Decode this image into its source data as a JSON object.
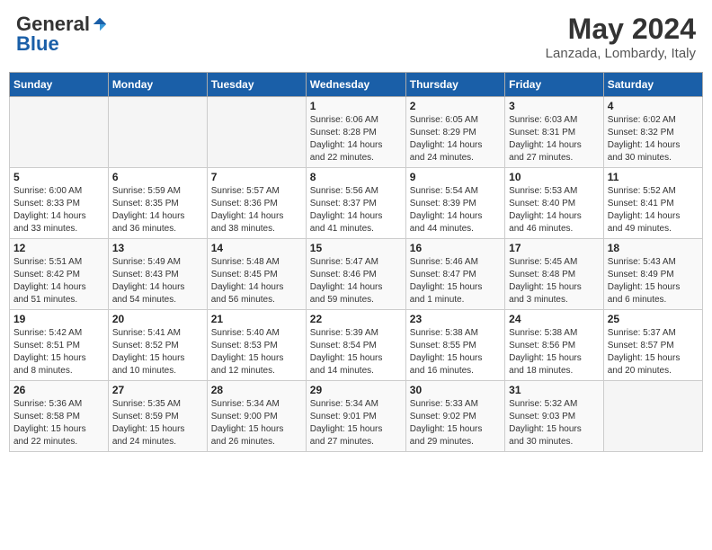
{
  "header": {
    "logo_general": "General",
    "logo_blue": "Blue",
    "title": "May 2024",
    "location": "Lanzada, Lombardy, Italy"
  },
  "weekdays": [
    "Sunday",
    "Monday",
    "Tuesday",
    "Wednesday",
    "Thursday",
    "Friday",
    "Saturday"
  ],
  "weeks": [
    [
      {
        "day": "",
        "info": ""
      },
      {
        "day": "",
        "info": ""
      },
      {
        "day": "",
        "info": ""
      },
      {
        "day": "1",
        "info": "Sunrise: 6:06 AM\nSunset: 8:28 PM\nDaylight: 14 hours\nand 22 minutes."
      },
      {
        "day": "2",
        "info": "Sunrise: 6:05 AM\nSunset: 8:29 PM\nDaylight: 14 hours\nand 24 minutes."
      },
      {
        "day": "3",
        "info": "Sunrise: 6:03 AM\nSunset: 8:31 PM\nDaylight: 14 hours\nand 27 minutes."
      },
      {
        "day": "4",
        "info": "Sunrise: 6:02 AM\nSunset: 8:32 PM\nDaylight: 14 hours\nand 30 minutes."
      }
    ],
    [
      {
        "day": "5",
        "info": "Sunrise: 6:00 AM\nSunset: 8:33 PM\nDaylight: 14 hours\nand 33 minutes."
      },
      {
        "day": "6",
        "info": "Sunrise: 5:59 AM\nSunset: 8:35 PM\nDaylight: 14 hours\nand 36 minutes."
      },
      {
        "day": "7",
        "info": "Sunrise: 5:57 AM\nSunset: 8:36 PM\nDaylight: 14 hours\nand 38 minutes."
      },
      {
        "day": "8",
        "info": "Sunrise: 5:56 AM\nSunset: 8:37 PM\nDaylight: 14 hours\nand 41 minutes."
      },
      {
        "day": "9",
        "info": "Sunrise: 5:54 AM\nSunset: 8:39 PM\nDaylight: 14 hours\nand 44 minutes."
      },
      {
        "day": "10",
        "info": "Sunrise: 5:53 AM\nSunset: 8:40 PM\nDaylight: 14 hours\nand 46 minutes."
      },
      {
        "day": "11",
        "info": "Sunrise: 5:52 AM\nSunset: 8:41 PM\nDaylight: 14 hours\nand 49 minutes."
      }
    ],
    [
      {
        "day": "12",
        "info": "Sunrise: 5:51 AM\nSunset: 8:42 PM\nDaylight: 14 hours\nand 51 minutes."
      },
      {
        "day": "13",
        "info": "Sunrise: 5:49 AM\nSunset: 8:43 PM\nDaylight: 14 hours\nand 54 minutes."
      },
      {
        "day": "14",
        "info": "Sunrise: 5:48 AM\nSunset: 8:45 PM\nDaylight: 14 hours\nand 56 minutes."
      },
      {
        "day": "15",
        "info": "Sunrise: 5:47 AM\nSunset: 8:46 PM\nDaylight: 14 hours\nand 59 minutes."
      },
      {
        "day": "16",
        "info": "Sunrise: 5:46 AM\nSunset: 8:47 PM\nDaylight: 15 hours\nand 1 minute."
      },
      {
        "day": "17",
        "info": "Sunrise: 5:45 AM\nSunset: 8:48 PM\nDaylight: 15 hours\nand 3 minutes."
      },
      {
        "day": "18",
        "info": "Sunrise: 5:43 AM\nSunset: 8:49 PM\nDaylight: 15 hours\nand 6 minutes."
      }
    ],
    [
      {
        "day": "19",
        "info": "Sunrise: 5:42 AM\nSunset: 8:51 PM\nDaylight: 15 hours\nand 8 minutes."
      },
      {
        "day": "20",
        "info": "Sunrise: 5:41 AM\nSunset: 8:52 PM\nDaylight: 15 hours\nand 10 minutes."
      },
      {
        "day": "21",
        "info": "Sunrise: 5:40 AM\nSunset: 8:53 PM\nDaylight: 15 hours\nand 12 minutes."
      },
      {
        "day": "22",
        "info": "Sunrise: 5:39 AM\nSunset: 8:54 PM\nDaylight: 15 hours\nand 14 minutes."
      },
      {
        "day": "23",
        "info": "Sunrise: 5:38 AM\nSunset: 8:55 PM\nDaylight: 15 hours\nand 16 minutes."
      },
      {
        "day": "24",
        "info": "Sunrise: 5:38 AM\nSunset: 8:56 PM\nDaylight: 15 hours\nand 18 minutes."
      },
      {
        "day": "25",
        "info": "Sunrise: 5:37 AM\nSunset: 8:57 PM\nDaylight: 15 hours\nand 20 minutes."
      }
    ],
    [
      {
        "day": "26",
        "info": "Sunrise: 5:36 AM\nSunset: 8:58 PM\nDaylight: 15 hours\nand 22 minutes."
      },
      {
        "day": "27",
        "info": "Sunrise: 5:35 AM\nSunset: 8:59 PM\nDaylight: 15 hours\nand 24 minutes."
      },
      {
        "day": "28",
        "info": "Sunrise: 5:34 AM\nSunset: 9:00 PM\nDaylight: 15 hours\nand 26 minutes."
      },
      {
        "day": "29",
        "info": "Sunrise: 5:34 AM\nSunset: 9:01 PM\nDaylight: 15 hours\nand 27 minutes."
      },
      {
        "day": "30",
        "info": "Sunrise: 5:33 AM\nSunset: 9:02 PM\nDaylight: 15 hours\nand 29 minutes."
      },
      {
        "day": "31",
        "info": "Sunrise: 5:32 AM\nSunset: 9:03 PM\nDaylight: 15 hours\nand 30 minutes."
      },
      {
        "day": "",
        "info": ""
      }
    ]
  ]
}
